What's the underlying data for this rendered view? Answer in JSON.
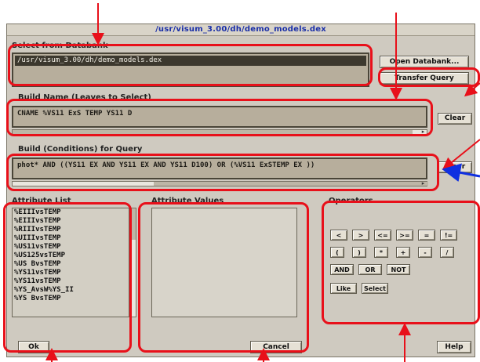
{
  "window": {
    "title": "/usr/visum_3.00/dh/demo_models.dex"
  },
  "select_from_databank": {
    "label": "Select from Databank",
    "path_value": "/usr/visum_3.00/dh/demo_models.dex",
    "open_button": "Open Databank...",
    "transfer_button": "Transfer Query"
  },
  "build_names": {
    "label": "Build Name (Leaves to Select)",
    "value": "CNAME %VS11 ExS TEMP YS11 D",
    "clear_button": "Clear"
  },
  "build_conditions": {
    "label": "Build (Conditions) for Query",
    "value": "phot* AND ((YS11 EX AND YS11 EX AND YS11 D100) OR (%VS11 ExSTEMP EX ))",
    "clear_button": "Clear"
  },
  "attribute_list": {
    "label": "Attribute List",
    "items": [
      "%EIIIvsTEMP",
      "%EIIIvsTEMP",
      "%RIIIvsTEMP",
      "%UIIIvsTEMP",
      "%US11vsTEMP",
      "%US125vsTEMP",
      "%US BvsTEMP",
      "%YS11vsTEMP",
      "%YS11vsTEMP",
      "%YS_AvsW%YS_II",
      "%YS BvsTEMP"
    ]
  },
  "middle_list": {
    "label": "Attribute Values"
  },
  "operators": {
    "label": "Operators",
    "row1": [
      "<",
      ">",
      "<=",
      ">=",
      "=",
      "!="
    ],
    "row2": [
      "(",
      ")",
      "*",
      "+",
      "-",
      "/"
    ],
    "row3": [
      "AND",
      "OR",
      "NOT"
    ],
    "row4": [
      "Like",
      "Select"
    ]
  },
  "bottom": {
    "ok": "Ok",
    "cancel": "Cancel",
    "help": "Help"
  },
  "colors": {
    "highlight": "#e8101a",
    "arrow_red": "#e8101a",
    "arrow_blue": "#1030e0"
  }
}
